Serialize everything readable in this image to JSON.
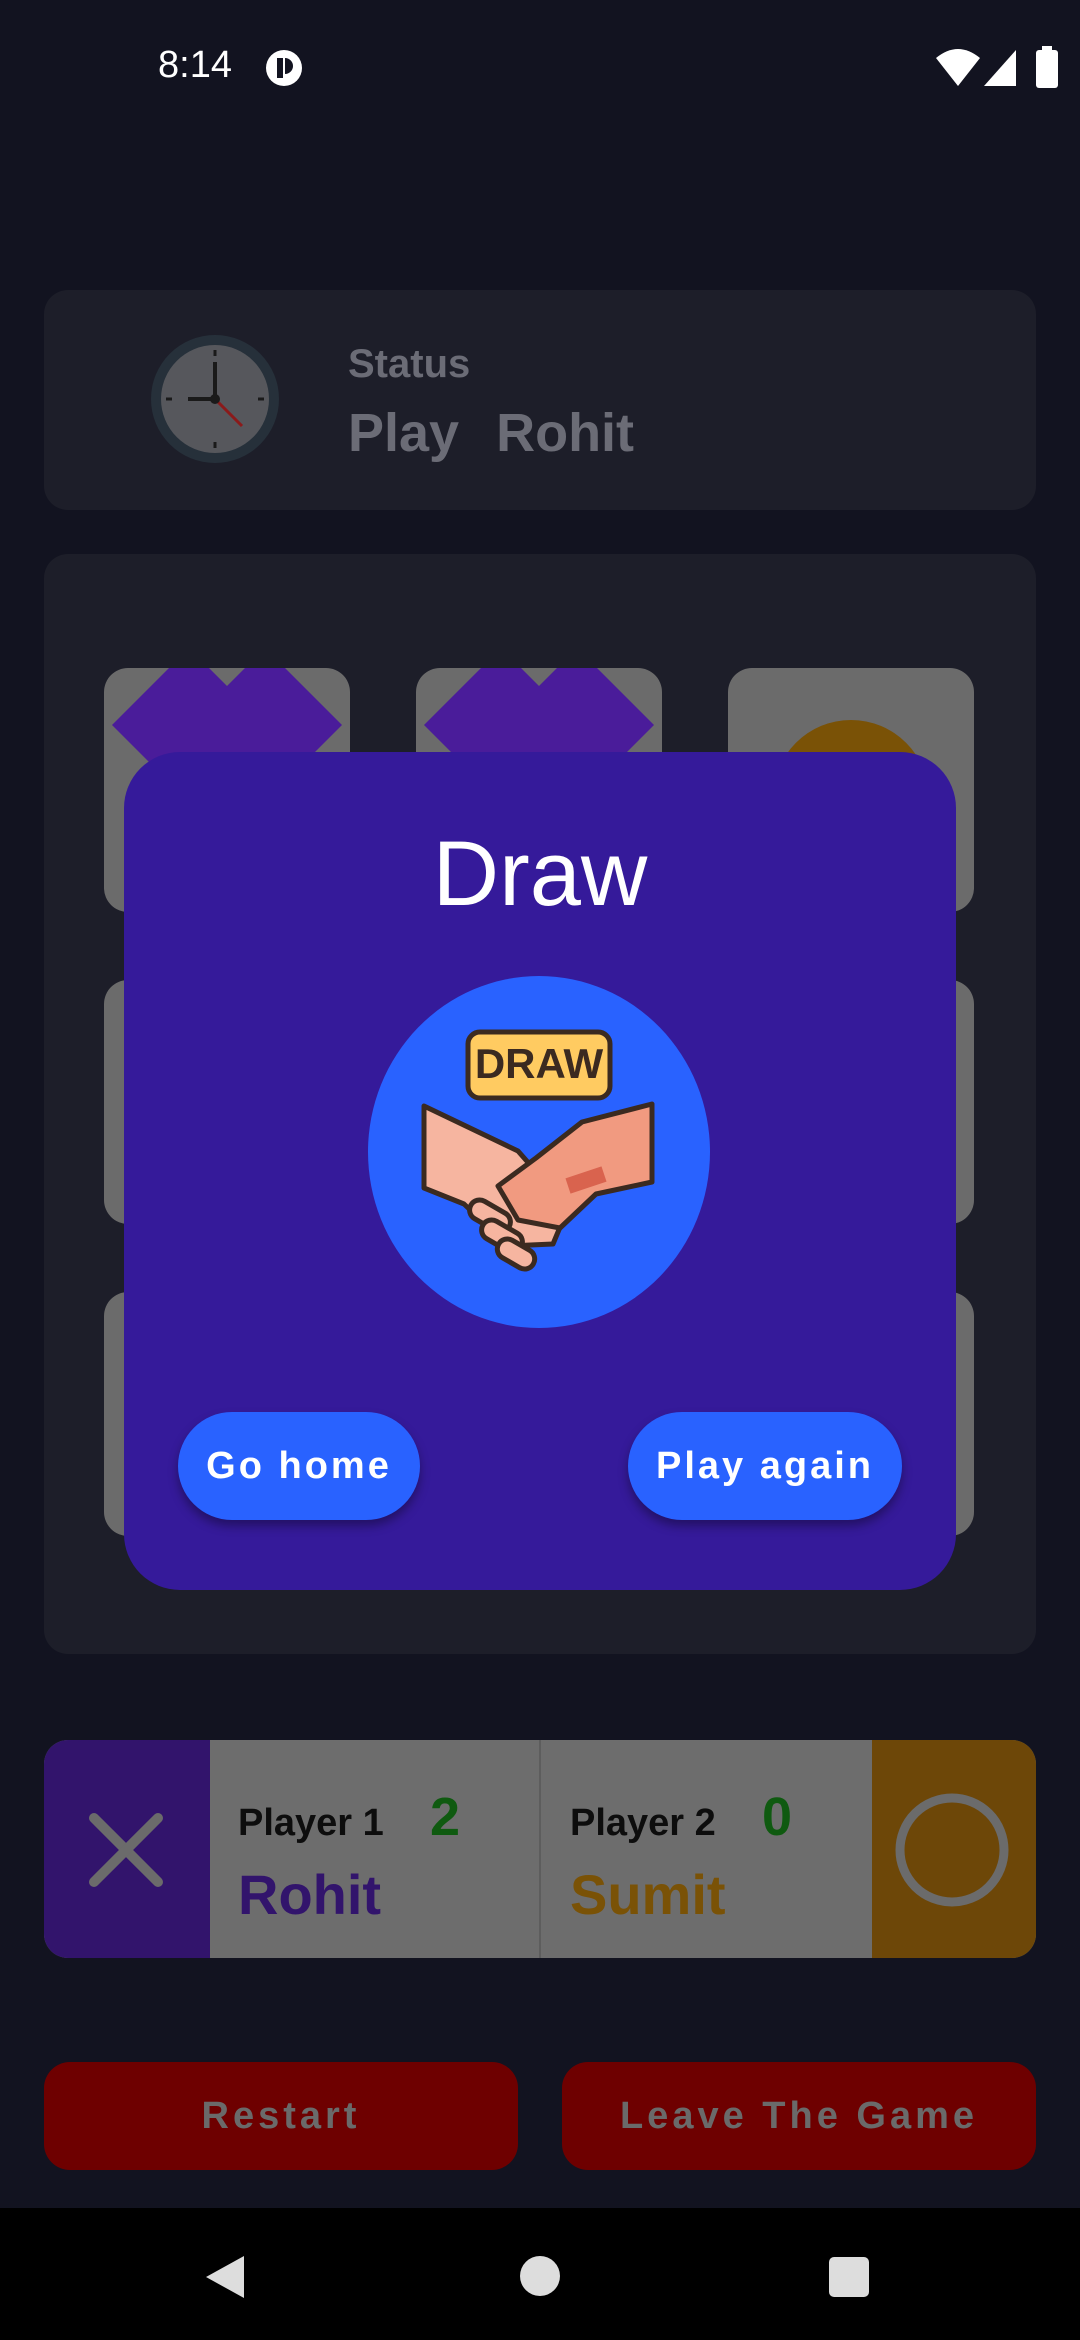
{
  "status_bar": {
    "time": "8:14"
  },
  "status_card": {
    "label": "Status",
    "text": "Play Rohit"
  },
  "board": {
    "cells": [
      "X",
      "X",
      "O",
      "",
      "",
      "",
      "",
      "",
      ""
    ]
  },
  "dialog": {
    "title": "Draw",
    "badge_text": "DRAW",
    "go_home_label": "Go home",
    "play_again_label": "Play again"
  },
  "players": {
    "p1": {
      "label": "Player 1",
      "score": "2",
      "name": "Rohit",
      "mark": "X"
    },
    "p2": {
      "label": "Player 2",
      "score": "0",
      "name": "Sumit",
      "mark": "O"
    }
  },
  "actions": {
    "restart_label": "Restart",
    "leave_label": "Leave The Game"
  },
  "colors": {
    "background": "#121320",
    "card": "#1d1e29",
    "dialog": "#351a9a",
    "accent_blue": "#2962ff",
    "p1_color": "#4a1c9a",
    "p2_color": "#b7780d",
    "danger": "#6e0000"
  },
  "icons": [
    "notification-icon",
    "wifi-icon",
    "cell-signal-icon",
    "battery-icon",
    "clock-icon",
    "handshake-icon",
    "close-x-icon",
    "circle-o-icon",
    "back-icon",
    "home-icon",
    "recents-icon"
  ]
}
